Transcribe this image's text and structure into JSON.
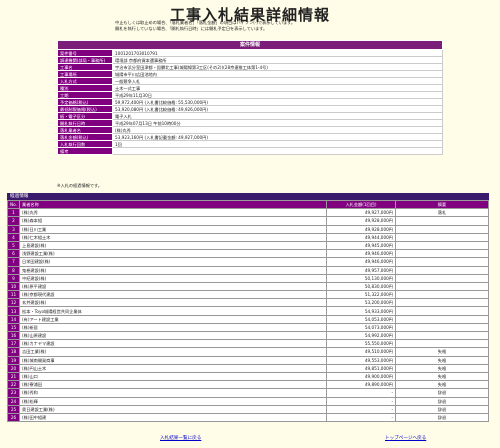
{
  "title": "工事入札結果詳細情報",
  "notes": [
    "中止もしくは取止めの場合、「落札業者名」「落札金額」の項目はハイフン(-)で表示しています。",
    "開札を執行していない場合、「開札執行日時」には開札予定日を表示しています。"
  ],
  "info_header": "案件情報",
  "info_rows": [
    {
      "label": "案件番号",
      "value": "1001201703010791"
    },
    {
      "label": "調達機関(部局・事務所)",
      "value": "環境部 京都府資本還事務所"
    },
    {
      "label": "工事名",
      "value": "宇治市浜分室田津都・鉛鬱北工事(城陽線第3工区(その2))(28京連推工体第1-4号)"
    },
    {
      "label": "工事場所",
      "value": "城陽市平川広田池地内"
    },
    {
      "label": "入札方式",
      "value": "一般競争入札"
    },
    {
      "label": "種別",
      "value": "土木一式工事"
    },
    {
      "label": "工期",
      "value": "平成29年11月30日"
    },
    {
      "label": "予定価格(税込)",
      "value": "59,972,400円 (入札書比較価格: 55,530,000円)"
    },
    {
      "label": "最低制限価格(税込)",
      "value": "53,920,080円 (入札書比較価格: 49,926,000円)"
    },
    {
      "label": "紙・電子区分",
      "value": "電子入札"
    },
    {
      "label": "開札執行日時",
      "value": "平成29年07月13日 午前10時00分"
    },
    {
      "label": "落札業者名",
      "value": "(株)丸秀"
    },
    {
      "label": "落札金額(税込)",
      "value": "53,923,160円 (入札書記載金額: 49,927,000円)"
    },
    {
      "label": "入札執行回数",
      "value": "1回"
    },
    {
      "label": "備考",
      "value": ""
    }
  ],
  "no_change_msg": "※入札の経過情報です。",
  "bid_section_title": "経過情報",
  "bid_headers": {
    "no": "No.",
    "name": "業者名称",
    "amount": "入札金額(1回目)",
    "remark": "摘要"
  },
  "bids": [
    {
      "no": "1",
      "name": "(株)丸秀",
      "amount": "49,927,000円",
      "remark": "落札"
    },
    {
      "no": "2",
      "name": "(株)森本組",
      "amount": "49,928,000円",
      "remark": ""
    },
    {
      "no": "3",
      "name": "(株)日川工業",
      "amount": "49,928,000円",
      "remark": ""
    },
    {
      "no": "4",
      "name": "(株)仁木組土木",
      "amount": "49,944,000円",
      "remark": ""
    },
    {
      "no": "5",
      "name": "上島建設(株)",
      "amount": "49,945,000円",
      "remark": ""
    },
    {
      "no": "6",
      "name": "浅野建設工業(株)",
      "amount": "49,946,000円",
      "remark": ""
    },
    {
      "no": "7",
      "name": "日栄田建設(株)",
      "amount": "49,946,000円",
      "remark": ""
    },
    {
      "no": "8",
      "name": "鬼巻建設(株)",
      "amount": "49,957,000円",
      "remark": ""
    },
    {
      "no": "9",
      "name": "中紀建設(株)",
      "amount": "50,130,000円",
      "remark": ""
    },
    {
      "no": "10",
      "name": "(株)原平建設",
      "amount": "50,830,000円",
      "remark": ""
    },
    {
      "no": "11",
      "name": "(株)京都現代建設",
      "amount": "51,322,000円",
      "remark": ""
    },
    {
      "no": "12",
      "name": "玄井建設(株)",
      "amount": "53,200,000円",
      "remark": ""
    },
    {
      "no": "13",
      "name": "松本・Toyo城陽経営共同企業体",
      "amount": "54,933,000円",
      "remark": ""
    },
    {
      "no": "14",
      "name": "(有)アート建設工業",
      "amount": "54,053,000円",
      "remark": ""
    },
    {
      "no": "15",
      "name": "(株)新居",
      "amount": "54,073,000円",
      "remark": ""
    },
    {
      "no": "16",
      "name": "(株)山原建設",
      "amount": "54,992,000円",
      "remark": ""
    },
    {
      "no": "17",
      "name": "(株)カナヤマ建設",
      "amount": "55,550,000円",
      "remark": ""
    },
    {
      "no": "18",
      "name": "吉田工業(株)",
      "amount": "49,510,000円",
      "remark": "失格"
    },
    {
      "no": "19",
      "name": "(株)城南開発商事",
      "amount": "49,553,000円",
      "remark": "失格"
    },
    {
      "no": "20",
      "name": "(株)円山土木",
      "amount": "49,851,000円",
      "remark": "失格"
    },
    {
      "no": "21",
      "name": "(株)山口",
      "amount": "49,900,000円",
      "remark": "失格"
    },
    {
      "no": "22",
      "name": "(株)寮浦田",
      "amount": "49,890,000円",
      "remark": "失格"
    },
    {
      "no": "23",
      "name": "(株)秀和",
      "amount": "-",
      "remark": "辞退"
    },
    {
      "no": "24",
      "name": "(株)松輝",
      "amount": "-",
      "remark": "辞退"
    },
    {
      "no": "25",
      "name": "奥日建設工業(株)",
      "amount": "-",
      "remark": "辞退"
    },
    {
      "no": "26",
      "name": "(株)田中組建",
      "amount": "-",
      "remark": "辞退"
    }
  ],
  "footer": {
    "back_link": "入札結果一覧に戻る",
    "top_link": "トップページへ戻る"
  }
}
